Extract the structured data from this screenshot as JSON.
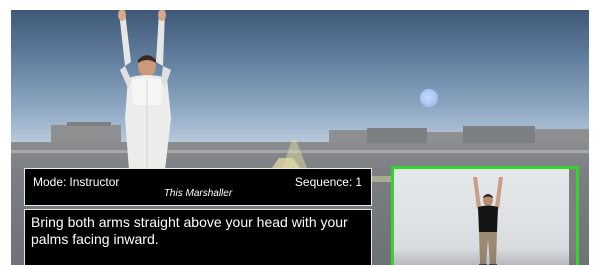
{
  "info_panel": {
    "mode_label": "Mode:",
    "mode_value": "Instructor",
    "sequence_label": "Sequence:",
    "sequence_value": "1",
    "signal_title": "This Marshaller"
  },
  "instruction_panel": {
    "text": "Bring both arms straight above your head with your palms facing inward."
  },
  "colors": {
    "webcam_border": "#35d42d",
    "panel_background": "#000000",
    "panel_border": "#e8e8e8",
    "sky_top": "#3f5877",
    "sky_horizon": "#b8c8d8",
    "ground": "#7b7f83"
  },
  "icons": {
    "scene_sun": "sun-icon"
  }
}
